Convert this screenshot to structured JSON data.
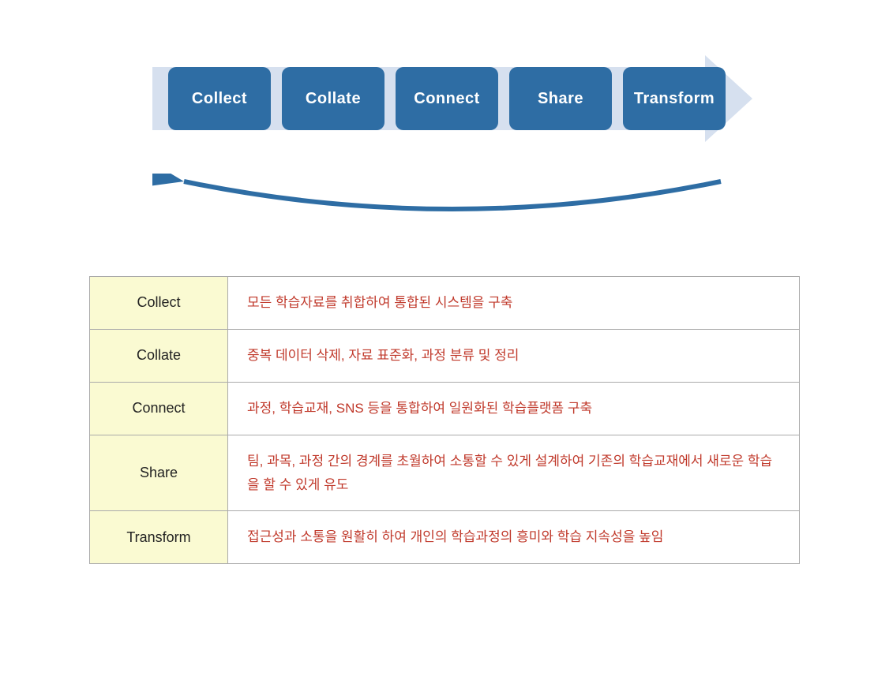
{
  "diagram": {
    "steps": [
      {
        "id": "collect",
        "label": "Collect"
      },
      {
        "id": "collate",
        "label": "Collate"
      },
      {
        "id": "connect",
        "label": "Connect"
      },
      {
        "id": "share",
        "label": "Share"
      },
      {
        "id": "transform",
        "label": "Transform"
      }
    ],
    "arrow_right_color": "#C5D3E8",
    "arrow_curve_color": "#2E6DA4"
  },
  "table": {
    "rows": [
      {
        "label": "Collect",
        "description": "모든 학습자료를 취합하여 통합된 시스템을 구축"
      },
      {
        "label": "Collate",
        "description": "중복 데이터 삭제, 자료 표준화, 과정 분류 및 정리"
      },
      {
        "label": "Connect",
        "description": "과정, 학습교재, SNS 등을 통합하여 일원화된 학습플랫폼 구축"
      },
      {
        "label": "Share",
        "description": "팀, 과목, 과정 간의 경계를 초월하여 소통할 수 있게 설계하여 기존의 학습교재에서 새로운 학습을 할 수 있게 유도"
      },
      {
        "label": "Transform",
        "description": "접근성과 소통을 원활히 하여 개인의 학습과정의 흥미와 학습 지속성을 높임"
      }
    ]
  }
}
